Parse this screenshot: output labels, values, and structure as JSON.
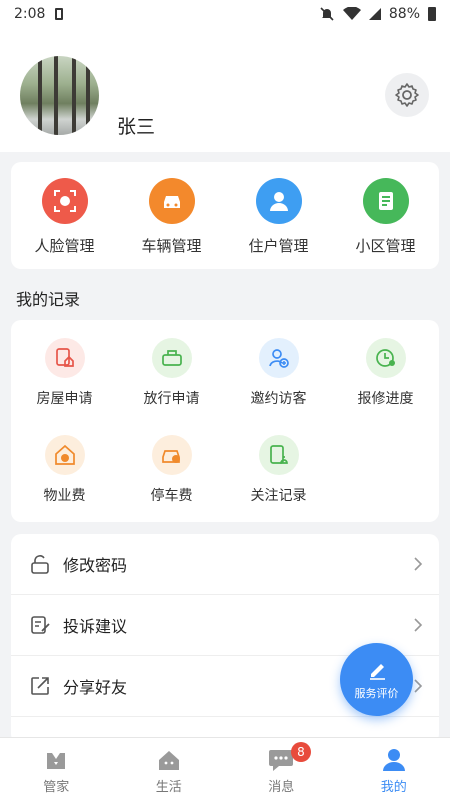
{
  "status_bar": {
    "time": "2:08",
    "battery": "88%"
  },
  "profile": {
    "name": "张三"
  },
  "management": [
    {
      "label": "人脸管理",
      "icon": "face-scan-icon",
      "color": "#ee5a4a"
    },
    {
      "label": "车辆管理",
      "icon": "car-icon",
      "color": "#f3892c"
    },
    {
      "label": "住户管理",
      "icon": "resident-icon",
      "color": "#3e9ef2"
    },
    {
      "label": "小区管理",
      "icon": "community-icon",
      "color": "#46b85a"
    }
  ],
  "records_title": "我的记录",
  "records": [
    {
      "label": "房屋申请",
      "icon": "house-application-icon"
    },
    {
      "label": "放行申请",
      "icon": "release-application-icon"
    },
    {
      "label": "邀约访客",
      "icon": "invite-visitor-icon"
    },
    {
      "label": "报修进度",
      "icon": "repair-progress-icon"
    },
    {
      "label": "物业费",
      "icon": "property-fee-icon"
    },
    {
      "label": "停车费",
      "icon": "parking-fee-icon"
    },
    {
      "label": "关注记录",
      "icon": "follow-record-icon"
    }
  ],
  "menu": [
    {
      "label": "修改密码",
      "icon": "lock-icon"
    },
    {
      "label": "投诉建议",
      "icon": "edit-note-icon"
    },
    {
      "label": "分享好友",
      "icon": "share-icon"
    }
  ],
  "fab": {
    "label": "服务评价"
  },
  "tabs": [
    {
      "label": "管家",
      "icon": "butler-icon"
    },
    {
      "label": "生活",
      "icon": "life-icon"
    },
    {
      "label": "消息",
      "icon": "message-icon",
      "badge": "8"
    },
    {
      "label": "我的",
      "icon": "me-icon"
    }
  ],
  "colors": {
    "accent": "#3c8cf4",
    "badge": "#e84b3c"
  }
}
